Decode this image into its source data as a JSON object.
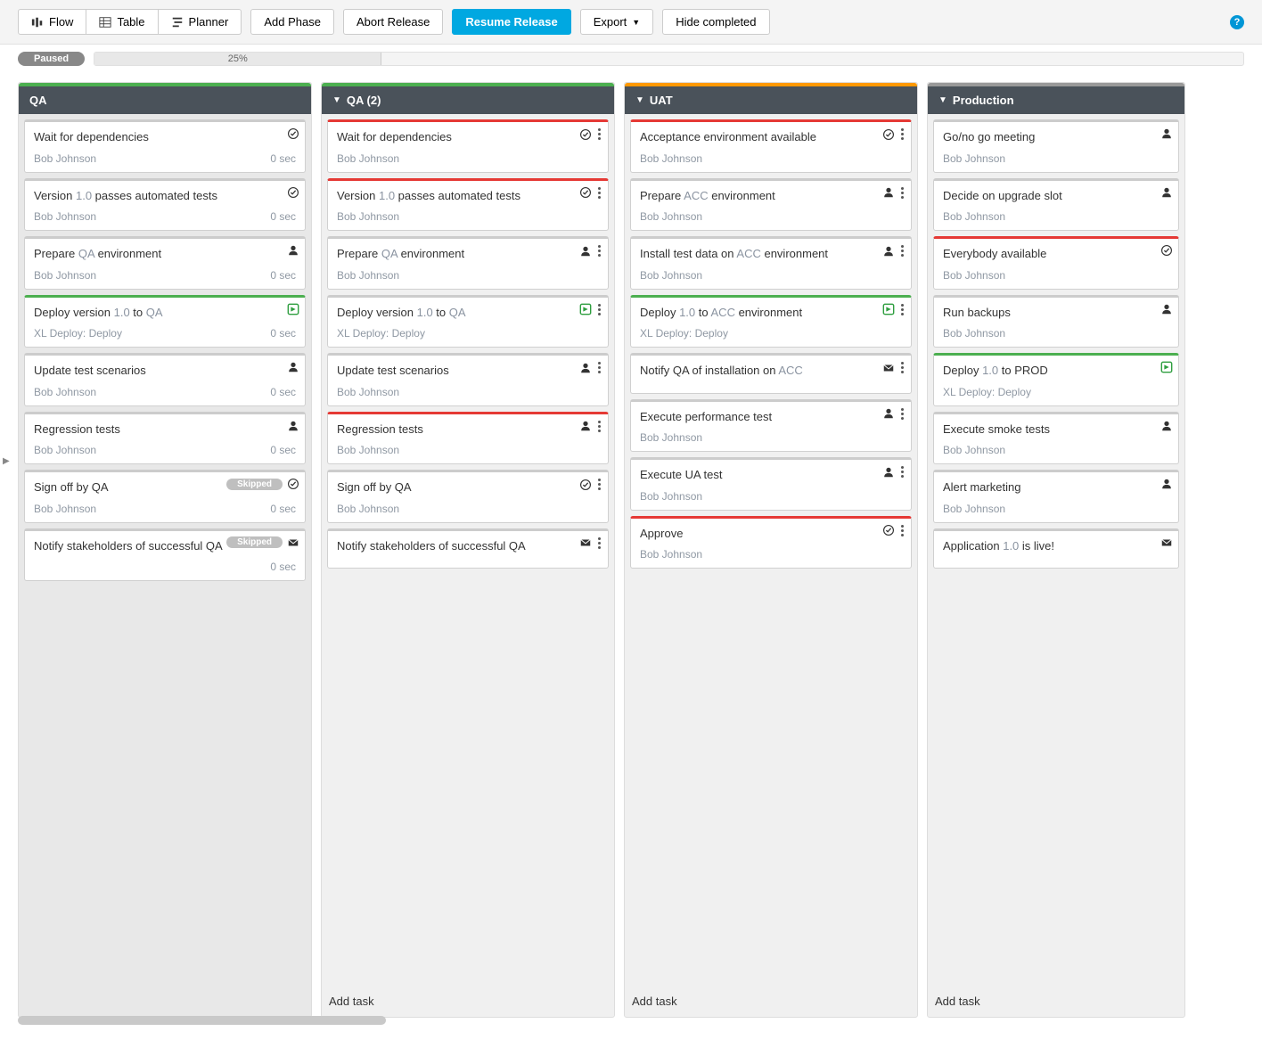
{
  "toolbar": {
    "tabs": {
      "flow": "Flow",
      "table": "Table",
      "planner": "Planner"
    },
    "addPhase": "Add Phase",
    "abort": "Abort Release",
    "resume": "Resume Release",
    "export": "Export",
    "hide": "Hide completed"
  },
  "status": {
    "state": "Paused",
    "percent": "25%"
  },
  "addTask": "Add task",
  "phases": [
    {
      "name": "QA",
      "top": "green",
      "done": true,
      "arrow": false,
      "tasks": [
        {
          "title": [
            [
              "",
              "Wait for dependencies"
            ]
          ],
          "assignee": "Bob Johnson",
          "duration": "0 sec",
          "border": "",
          "icon": "check",
          "menu": false
        },
        {
          "title": [
            [
              "",
              "Version "
            ],
            [
              "hl",
              "1.0"
            ],
            [
              "",
              " passes automated tests"
            ]
          ],
          "assignee": "Bob Johnson",
          "duration": "0 sec",
          "border": "",
          "icon": "check",
          "menu": false
        },
        {
          "title": [
            [
              "",
              "Prepare "
            ],
            [
              "hl",
              "QA"
            ],
            [
              "",
              " environment"
            ]
          ],
          "assignee": "Bob Johnson",
          "duration": "0 sec",
          "border": "",
          "icon": "user",
          "menu": false
        },
        {
          "title": [
            [
              "",
              "Deploy version "
            ],
            [
              "hl",
              "1.0"
            ],
            [
              "",
              " to "
            ],
            [
              "hl",
              "QA"
            ]
          ],
          "assignee": "XL Deploy: Deploy",
          "duration": "0 sec",
          "border": "bgreen",
          "icon": "deploy",
          "menu": false
        },
        {
          "title": [
            [
              "",
              "Update test scenarios"
            ]
          ],
          "assignee": "Bob Johnson",
          "duration": "0 sec",
          "border": "",
          "icon": "user",
          "menu": false
        },
        {
          "title": [
            [
              "",
              "Regression tests"
            ]
          ],
          "assignee": "Bob Johnson",
          "duration": "0 sec",
          "border": "",
          "icon": "user",
          "menu": false
        },
        {
          "title": [
            [
              "",
              "Sign off by QA"
            ]
          ],
          "assignee": "Bob Johnson",
          "duration": "0 sec",
          "border": "",
          "icon": "check",
          "skipped": true,
          "menu": false
        },
        {
          "title": [
            [
              "",
              "Notify stakeholders of successful QA"
            ]
          ],
          "assignee": "",
          "duration": "0 sec",
          "border": "",
          "icon": "mail",
          "skipped": true,
          "menu": false
        }
      ]
    },
    {
      "name": "QA (2)",
      "top": "green",
      "done": false,
      "arrow": true,
      "tasks": [
        {
          "title": [
            [
              "",
              "Wait for dependencies"
            ]
          ],
          "assignee": "Bob Johnson",
          "duration": "",
          "border": "bred",
          "icon": "check",
          "menu": true
        },
        {
          "title": [
            [
              "",
              "Version "
            ],
            [
              "hl",
              "1.0"
            ],
            [
              "",
              " passes automated tests"
            ]
          ],
          "assignee": "Bob Johnson",
          "duration": "",
          "border": "bred",
          "icon": "check",
          "menu": true
        },
        {
          "title": [
            [
              "",
              "Prepare "
            ],
            [
              "hl",
              "QA"
            ],
            [
              "",
              " environment"
            ]
          ],
          "assignee": "Bob Johnson",
          "duration": "",
          "border": "",
          "icon": "user",
          "menu": true
        },
        {
          "title": [
            [
              "",
              "Deploy version "
            ],
            [
              "hl",
              "1.0"
            ],
            [
              "",
              " to "
            ],
            [
              "hl",
              "QA"
            ]
          ],
          "assignee": "XL Deploy: Deploy",
          "duration": "",
          "border": "",
          "icon": "deploy",
          "menu": true
        },
        {
          "title": [
            [
              "",
              "Update test scenarios"
            ]
          ],
          "assignee": "Bob Johnson",
          "duration": "",
          "border": "",
          "icon": "user",
          "menu": true
        },
        {
          "title": [
            [
              "",
              "Regression tests"
            ]
          ],
          "assignee": "Bob Johnson",
          "duration": "",
          "border": "bred",
          "icon": "user",
          "menu": true
        },
        {
          "title": [
            [
              "",
              "Sign off by QA"
            ]
          ],
          "assignee": "Bob Johnson",
          "duration": "",
          "border": "",
          "icon": "check",
          "menu": true
        },
        {
          "title": [
            [
              "",
              "Notify stakeholders of successful QA"
            ]
          ],
          "assignee": "",
          "duration": "",
          "border": "",
          "icon": "mail",
          "menu": true
        }
      ]
    },
    {
      "name": "UAT",
      "top": "orange",
      "done": false,
      "arrow": true,
      "tasks": [
        {
          "title": [
            [
              "",
              "Acceptance environment available"
            ]
          ],
          "assignee": "Bob Johnson",
          "duration": "",
          "border": "bred",
          "icon": "check",
          "menu": true
        },
        {
          "title": [
            [
              "",
              "Prepare "
            ],
            [
              "hl",
              "ACC"
            ],
            [
              "",
              " environment"
            ]
          ],
          "assignee": "Bob Johnson",
          "duration": "",
          "border": "",
          "icon": "user",
          "menu": true
        },
        {
          "title": [
            [
              "",
              "Install test data on "
            ],
            [
              "hl",
              "ACC"
            ],
            [
              "",
              " environment"
            ]
          ],
          "assignee": "Bob Johnson",
          "duration": "",
          "border": "",
          "icon": "user",
          "menu": true
        },
        {
          "title": [
            [
              "",
              "Deploy "
            ],
            [
              "hl",
              "1.0"
            ],
            [
              "",
              " to "
            ],
            [
              "hl",
              "ACC"
            ],
            [
              "",
              " environment"
            ]
          ],
          "assignee": "XL Deploy: Deploy",
          "duration": "",
          "border": "bgreen",
          "icon": "deploy",
          "menu": true
        },
        {
          "title": [
            [
              "",
              "Notify QA of installation on "
            ],
            [
              "hl",
              "ACC"
            ]
          ],
          "assignee": "",
          "duration": "",
          "border": "",
          "icon": "mail",
          "menu": true
        },
        {
          "title": [
            [
              "",
              "Execute performance test"
            ]
          ],
          "assignee": "Bob Johnson",
          "duration": "",
          "border": "",
          "icon": "user",
          "menu": true
        },
        {
          "title": [
            [
              "",
              "Execute UA test"
            ]
          ],
          "assignee": "Bob Johnson",
          "duration": "",
          "border": "",
          "icon": "user",
          "menu": true
        },
        {
          "title": [
            [
              "",
              "Approve"
            ]
          ],
          "assignee": "Bob Johnson",
          "duration": "",
          "border": "bred",
          "icon": "check",
          "menu": true
        }
      ]
    },
    {
      "name": "Production",
      "top": "gray",
      "done": false,
      "arrow": true,
      "clipped": true,
      "tasks": [
        {
          "title": [
            [
              "",
              "Go/no go meeting"
            ]
          ],
          "assignee": "Bob Johnson",
          "duration": "",
          "border": "",
          "icon": "user",
          "menu": false
        },
        {
          "title": [
            [
              "",
              "Decide on upgrade slot"
            ]
          ],
          "assignee": "Bob Johnson",
          "duration": "",
          "border": "",
          "icon": "user",
          "menu": false
        },
        {
          "title": [
            [
              "",
              "Everybody available"
            ]
          ],
          "assignee": "Bob Johnson",
          "duration": "",
          "border": "bred",
          "icon": "check",
          "menu": false
        },
        {
          "title": [
            [
              "",
              "Run backups"
            ]
          ],
          "assignee": "Bob Johnson",
          "duration": "",
          "border": "",
          "icon": "user",
          "menu": false
        },
        {
          "title": [
            [
              "",
              "Deploy "
            ],
            [
              "hl",
              "1.0"
            ],
            [
              "",
              " to PROD"
            ]
          ],
          "assignee": "XL Deploy: Deploy",
          "duration": "",
          "border": "bgreen",
          "icon": "deploy",
          "menu": false
        },
        {
          "title": [
            [
              "",
              "Execute smoke tests"
            ]
          ],
          "assignee": "Bob Johnson",
          "duration": "",
          "border": "",
          "icon": "user",
          "menu": false
        },
        {
          "title": [
            [
              "",
              "Alert marketing"
            ]
          ],
          "assignee": "Bob Johnson",
          "duration": "",
          "border": "",
          "icon": "user",
          "menu": false
        },
        {
          "title": [
            [
              "",
              "Application "
            ],
            [
              "hl",
              "1.0"
            ],
            [
              "",
              " is live!"
            ]
          ],
          "assignee": "",
          "duration": "",
          "border": "",
          "icon": "mail",
          "menu": false
        }
      ]
    }
  ]
}
